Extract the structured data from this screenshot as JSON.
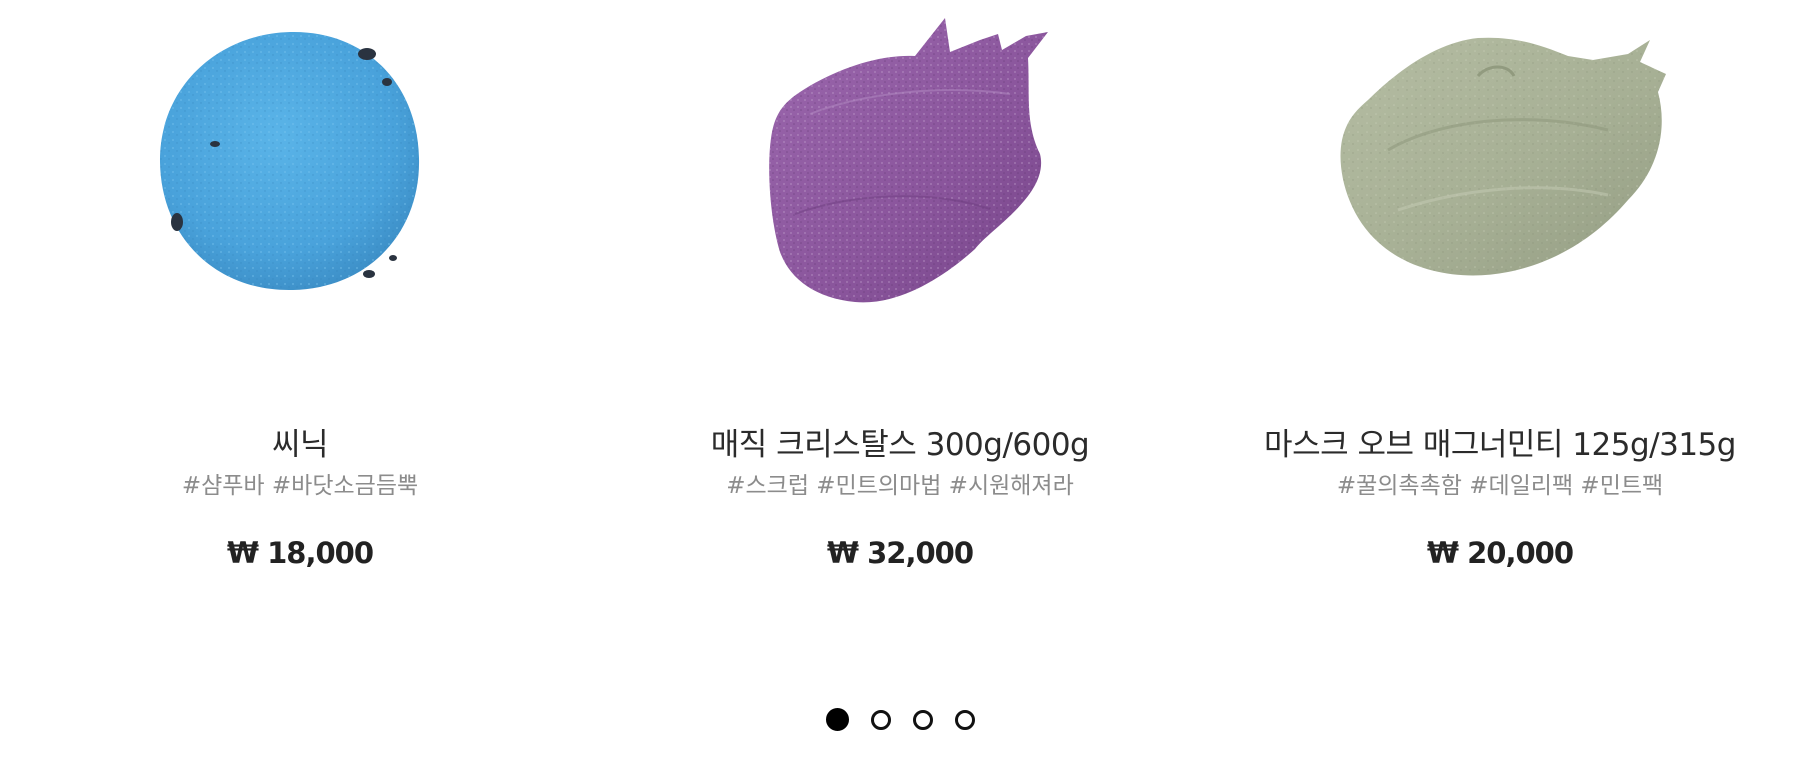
{
  "products": [
    {
      "name": "씨닉",
      "tags": "#샴푸바 #바닷소금듬뿍",
      "price": "₩ 18,000",
      "image_icon": "shampoo-bar-image",
      "color": "#4aa3dc"
    },
    {
      "name": "매직 크리스탈스 300g/600g",
      "tags": "#스크럽 #민트의마법 #시원해져라",
      "price": "₩ 32,000",
      "image_icon": "scrub-swatch-image",
      "color": "#8e5a9f"
    },
    {
      "name": "마스크 오브 매그너민티 125g/315g",
      "tags": "#꿀의촉촉함 #데일리팩 #민트팩",
      "price": "₩ 20,000",
      "image_icon": "face-mask-swatch-image",
      "color": "#a9b297"
    }
  ],
  "pager": {
    "count": 4,
    "active_index": 0
  }
}
